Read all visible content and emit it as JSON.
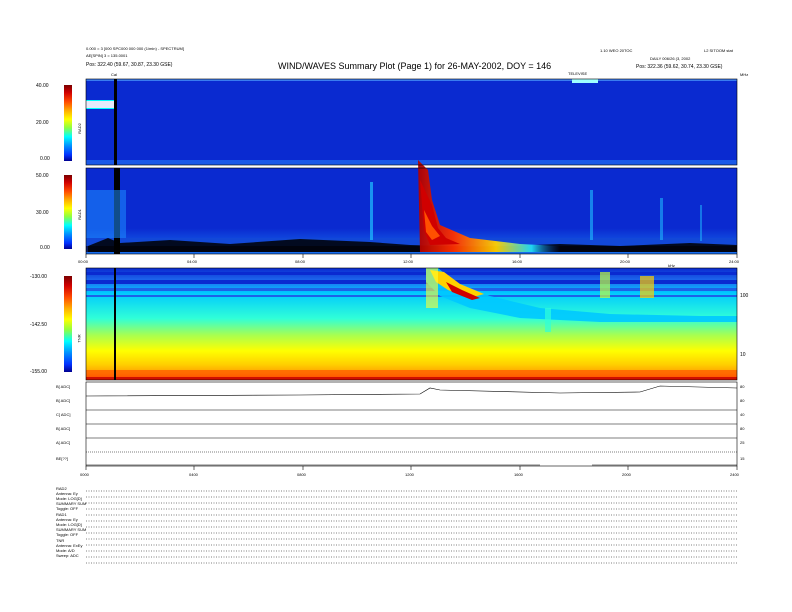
{
  "header": {
    "title": "WIND/WAVES Summary Plot (Page 1) for 26-MAY-2002, DOY = 146",
    "left_line1": "0.000 = 3 [000 SPC000 000 000 (1/min) - SPECTRUM]",
    "left_line2": "AE[SPIN] 3 = 135.0001",
    "left_line3": "Pos:   322.40 (59.67, 30.87, 23.30 GSE)",
    "right_line1": "1.10 WEO 20TOC",
    "right_line2": "DAILY 006/26 (3, 2002",
    "right_line3": "Pos:   322.36 (59.62, 30.74, 23.30 GSE)",
    "right_corner": "L2 SITOOM stat",
    "marker_cal": "Cal",
    "marker_mid": "TELEVISE"
  },
  "panels": {
    "rad2": {
      "label": "RAD2",
      "ticks": [
        "40.00",
        "20.00",
        "0.00"
      ]
    },
    "rad1": {
      "label": "RAD1",
      "ticks": [
        "50.00",
        "30.00",
        "0.00"
      ]
    },
    "tnr": {
      "label": "TNR",
      "ticks": [
        "-130.00",
        "-142.50",
        "-155.00"
      ],
      "right_ticks": [
        "100",
        "10"
      ],
      "right_label": "kHz"
    },
    "time_ticks_top": [
      "00:00",
      "04:00",
      "08:00",
      "12:00",
      "16:00",
      "20:00",
      "24:00"
    ],
    "time_ticks_bottom": [
      "0000",
      "0400",
      "0800",
      "1200",
      "1600",
      "2000",
      "2400"
    ],
    "mhz_label": "MHz",
    "khz_label": "kHz"
  },
  "traces": [
    {
      "label": "B[ ADC]",
      "right": "80"
    },
    {
      "label": "B[ ADC]",
      "right": "80"
    },
    {
      "label": "C[ ADC]",
      "right": "40"
    },
    {
      "label": "B[ ADC]",
      "right": "80"
    },
    {
      "label": "A[ ADC]",
      "right": "25"
    },
    {
      "label": "BE[??]",
      "right": "15"
    }
  ],
  "footer": {
    "lines": [
      "RAD2",
      "Antenna:   Ey",
      "Mode:  LOG[D]",
      "SUMMARY SUM",
      "Toggle:    OFF",
      "RAD1",
      "Antenna:   Ey",
      "Mode:  LOG[D]",
      "SUMMARY SUM",
      "Toggle:    OFF",
      "TNR",
      "Antenna:  ExEy",
      "Mode:     A/D",
      "Sweep:    ADC"
    ]
  },
  "colors": {
    "colorbar": [
      "#7a0000",
      "#d10000",
      "#ff4a00",
      "#ffb000",
      "#ffff00",
      "#90ff40",
      "#00ffff",
      "#0090ff",
      "#0030ff",
      "#000090"
    ],
    "background_blue": "#0a2ad0"
  }
}
